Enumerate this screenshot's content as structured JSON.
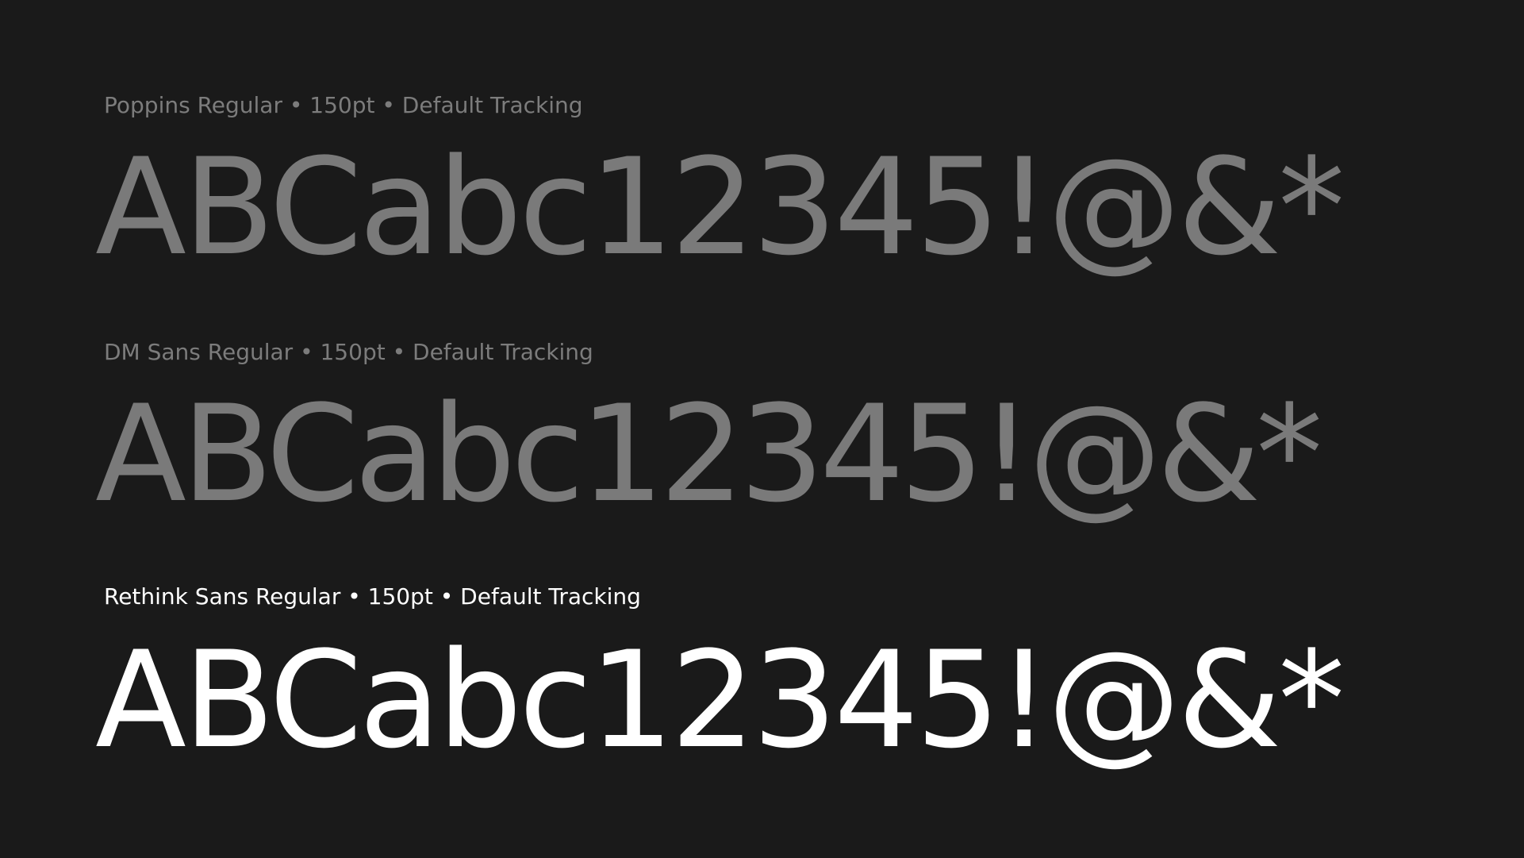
{
  "colors": {
    "background": "#1a1a1a",
    "muted_text": "#7a7a7a",
    "active_text": "#ffffff"
  },
  "specimens": [
    {
      "caption": "Poppins Regular • 150pt • Default Tracking",
      "sample": "ABCabc12345!@&*",
      "state": "muted"
    },
    {
      "caption": "DM Sans Regular • 150pt • Default Tracking",
      "sample": "ABCabc12345!@&*",
      "state": "muted"
    },
    {
      "caption": "Rethink Sans Regular • 150pt • Default Tracking",
      "sample": "ABCabc12345!@&*",
      "state": "active"
    }
  ]
}
